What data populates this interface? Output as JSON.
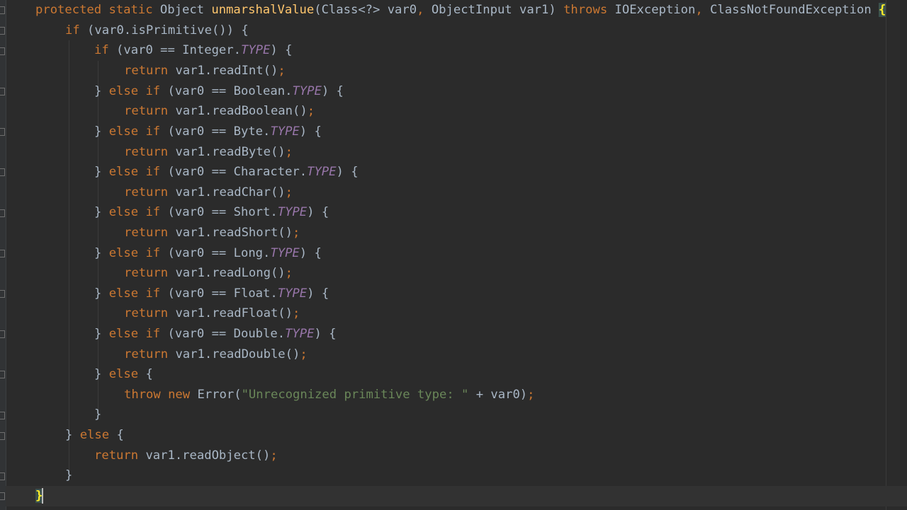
{
  "colors": {
    "background": "#2b2b2b",
    "keyword": "#cc7832",
    "method": "#ffc66d",
    "constant": "#9876aa",
    "string": "#6a8759",
    "text": "#a9b7c6",
    "brace_match": "#ffef28"
  },
  "code": {
    "l01": {
      "a": "protected static ",
      "b": "Object ",
      "c": "unmarshalValue",
      "d": "(Class<?> var0",
      "e": ", ",
      "f": "ObjectInput var1) ",
      "g": "throws ",
      "h": "IOException",
      "i": ", ",
      "j": "ClassNotFoundException ",
      "k": "{"
    },
    "l02": {
      "a": "if ",
      "b": "(var0.isPrimitive()) {"
    },
    "l03": {
      "a": "if ",
      "b": "(var0 == Integer.",
      "c": "TYPE",
      "d": ") {"
    },
    "l04": {
      "a": "return ",
      "b": "var1.readInt()",
      "c": ";"
    },
    "l05": {
      "a": "} ",
      "b": "else if ",
      "c": "(var0 == Boolean.",
      "d": "TYPE",
      "e": ") {"
    },
    "l06": {
      "a": "return ",
      "b": "var1.readBoolean()",
      "c": ";"
    },
    "l07": {
      "a": "} ",
      "b": "else if ",
      "c": "(var0 == Byte.",
      "d": "TYPE",
      "e": ") {"
    },
    "l08": {
      "a": "return ",
      "b": "var1.readByte()",
      "c": ";"
    },
    "l09": {
      "a": "} ",
      "b": "else if ",
      "c": "(var0 == Character.",
      "d": "TYPE",
      "e": ") {"
    },
    "l10": {
      "a": "return ",
      "b": "var1.readChar()",
      "c": ";"
    },
    "l11": {
      "a": "} ",
      "b": "else if ",
      "c": "(var0 == Short.",
      "d": "TYPE",
      "e": ") {"
    },
    "l12": {
      "a": "return ",
      "b": "var1.readShort()",
      "c": ";"
    },
    "l13": {
      "a": "} ",
      "b": "else if ",
      "c": "(var0 == Long.",
      "d": "TYPE",
      "e": ") {"
    },
    "l14": {
      "a": "return ",
      "b": "var1.readLong()",
      "c": ";"
    },
    "l15": {
      "a": "} ",
      "b": "else if ",
      "c": "(var0 == Float.",
      "d": "TYPE",
      "e": ") {"
    },
    "l16": {
      "a": "return ",
      "b": "var1.readFloat()",
      "c": ";"
    },
    "l17": {
      "a": "} ",
      "b": "else if ",
      "c": "(var0 == Double.",
      "d": "TYPE",
      "e": ") {"
    },
    "l18": {
      "a": "return ",
      "b": "var1.readDouble()",
      "c": ";"
    },
    "l19": {
      "a": "} ",
      "b": "else ",
      "c": "{"
    },
    "l20": {
      "a": "throw new ",
      "b": "Error(",
      "c": "\"Unrecognized primitive type: \"",
      "d": " + var0)",
      "e": ";"
    },
    "l21": {
      "a": "}"
    },
    "l22": {
      "a": "} ",
      "b": "else ",
      "c": "{"
    },
    "l23": {
      "a": "return ",
      "b": "var1.readObject()",
      "c": ";"
    },
    "l24": {
      "a": "}"
    },
    "l25": {
      "a": "}"
    }
  }
}
